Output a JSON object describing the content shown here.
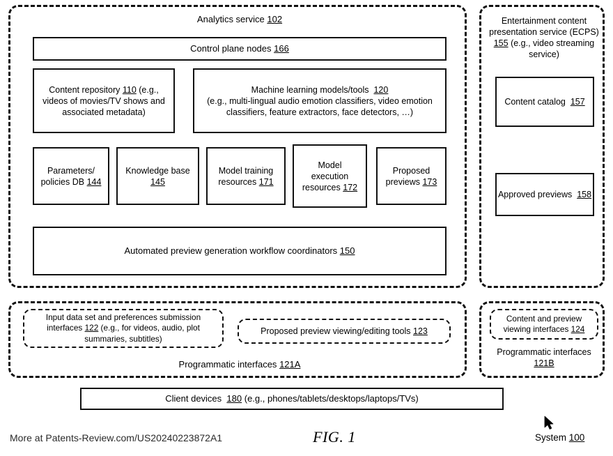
{
  "figure": {
    "caption": "FIG. 1",
    "system_label_text": "System",
    "system_label_ref": "100",
    "source_note": "More at Patents-Review.com/US20240223872A1",
    "cursor_icon": "mouse-pointer-icon"
  },
  "analytics_service": {
    "title_text": "Analytics service",
    "title_ref": "102",
    "control_plane": {
      "text": "Control plane nodes",
      "ref": "166"
    },
    "content_repository": {
      "line1_text": "Content repository",
      "line1_ref": "110",
      "line1_tail": "(e.g.,",
      "line2": "videos of movies/TV shows and",
      "line3": "associated metadata)"
    },
    "ml_models": {
      "line1_text": "Machine learning models/tools",
      "line1_ref": "120",
      "line2": "(e.g., multi-lingual audio emotion classifiers, video emotion",
      "line3": "classifiers, feature extractors, face detectors, …)"
    },
    "small_boxes": [
      {
        "name": "parameters-policies-db",
        "line1": "Parameters/",
        "line2": "policies DB",
        "ref": "144"
      },
      {
        "name": "knowledge-base",
        "line1": "Knowledge base",
        "line2": "",
        "ref": "145"
      },
      {
        "name": "model-training-resources",
        "line1": "Model training",
        "line2": "resources",
        "ref": "171"
      },
      {
        "name": "model-execution-resources",
        "line1": "Model",
        "line2": "execution",
        "line3": "resources",
        "ref": "172"
      },
      {
        "name": "proposed-previews",
        "line1": "Proposed",
        "line2": "previews",
        "ref": "173"
      }
    ],
    "workflow_coordinators": {
      "text": "Automated preview generation workflow coordinators",
      "ref": "150"
    }
  },
  "ecps": {
    "title_line1": "Entertainment content",
    "title_line2": "presentation service (ECPS)",
    "title_ref": "155",
    "title_line3_tail": "(e.g., video streaming",
    "title_line4": "service)",
    "content_catalog": {
      "text": "Content catalog",
      "ref": "157"
    },
    "approved_previews": {
      "text": "Approved previews",
      "ref": "158"
    }
  },
  "programmatic_interfaces_a": {
    "label_text": "Programmatic interfaces",
    "label_ref": "121A",
    "input_submission": {
      "line1": "Input data set and preferences submission",
      "line2_text": "interfaces",
      "line2_ref": "122",
      "line2_tail": "(e.g., for videos, audio, plot",
      "line3": "summaries, subtitles)"
    },
    "preview_tools": {
      "text": "Proposed preview viewing/editing tools",
      "ref": "123"
    }
  },
  "programmatic_interfaces_b": {
    "label_text": "Programmatic interfaces",
    "label_ref": "121B",
    "viewing_interfaces": {
      "line1": "Content and preview",
      "line2_text": "viewing interfaces",
      "line2_ref": "124"
    }
  },
  "client_devices": {
    "text": "Client devices",
    "ref": "180",
    "tail": "(e.g., phones/tablets/desktops/laptops/TVs)"
  }
}
